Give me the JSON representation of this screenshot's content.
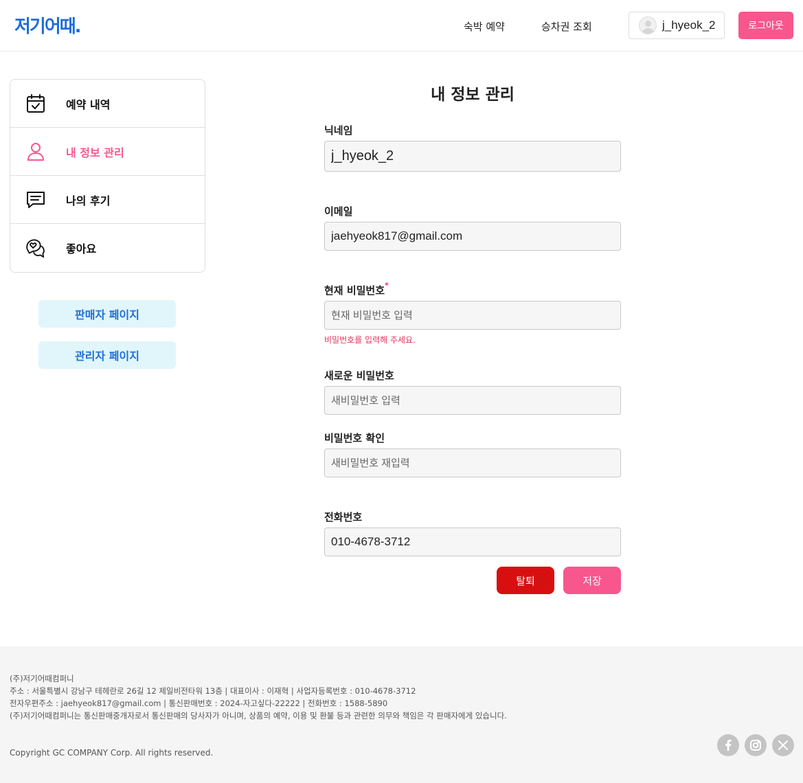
{
  "header": {
    "logo": "저기어때.",
    "nav": {
      "stay": "숙박 예약",
      "ticket": "승차권 조회"
    },
    "user_name": "j_hyeok_2",
    "logout_label": "로그아웃"
  },
  "sidebar": {
    "items": [
      {
        "label": "예약 내역",
        "icon": "calendar-check-icon"
      },
      {
        "label": "내 정보 관리",
        "icon": "user-icon"
      },
      {
        "label": "나의 후기",
        "icon": "chat-icon"
      },
      {
        "label": "좋아요",
        "icon": "heart-chat-icon"
      }
    ],
    "seller_label": "판매자 페이지",
    "admin_label": "관리자 페이지"
  },
  "form": {
    "title": "내 정보 관리",
    "nickname": {
      "label": "닉네임",
      "value": "j_hyeok_2"
    },
    "email": {
      "label": "이메일",
      "value": "jaehyeok817@gmail.com"
    },
    "current_password": {
      "label": "현재 비밀번호",
      "required": "*",
      "placeholder": "현재 비밀번호 입력",
      "error": "비밀번호를 입력해 주세요."
    },
    "new_password": {
      "label": "새로운 비밀번호",
      "placeholder": "새비밀번호 입력"
    },
    "confirm_password": {
      "label": "비밀번호 확인",
      "placeholder": "새비밀번호 재입력"
    },
    "phone": {
      "label": "전화번호",
      "value": "010-4678-3712"
    },
    "withdraw_label": "탈퇴",
    "save_label": "저장"
  },
  "footer": {
    "lines": [
      "(주)저기어때컴퍼니",
      "주소 : 서울특별시 강남구 테헤란로 26길 12 제일비전타워 13층 | 대표이사 : 이재혁 | 사업자등록번호 : 010-4678-3712",
      "전자우편주소 : jaehyeok817@gmail.com | 통신판매번호 : 2024-자고싶다-22222 | 전화번호 : 1588-5890",
      "(주)저기어때컴퍼니는 통신판매중개자로서 통신판매의 당사자가 아니며, 상품의 예약, 이용 및 환불 등과 관련한 의무와 책임은 각 판매자에게 있습니다."
    ],
    "copyright": "Copyright GC COMPANY Corp. All rights reserved.",
    "social": [
      "facebook-icon",
      "instagram-icon",
      "x-icon"
    ]
  },
  "colors": {
    "brand_blue": "#1e6ed8",
    "accent_pink": "#f7578c",
    "danger_red": "#d80f10",
    "error_text": "#e8335f",
    "side_button_bg": "#e0f6fb"
  }
}
